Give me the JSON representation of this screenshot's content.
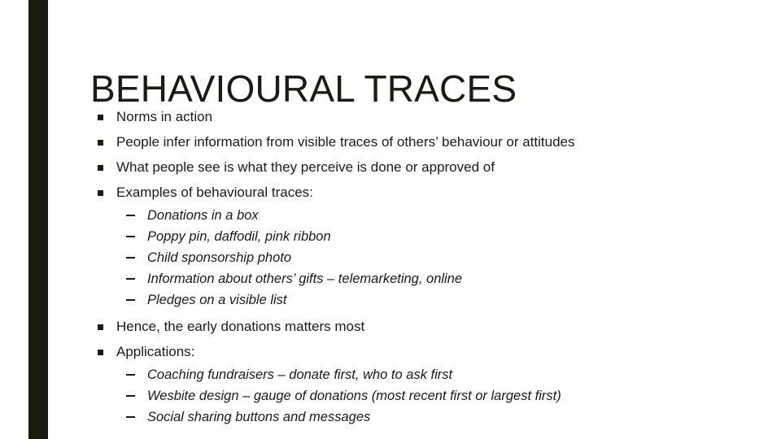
{
  "slide": {
    "title": "BEHAVIOURAL TRACES",
    "accent_color": "#1a1c10",
    "text_color": "#1a1a17",
    "background_color": "#ffffff",
    "bullet_marker": "filled-square",
    "sub_bullet_marker": "en-dash"
  },
  "content": {
    "items": [
      {
        "level": 1,
        "text": "Norms in action"
      },
      {
        "level": 1,
        "text": "People infer information from visible traces of others’ behaviour or attitudes"
      },
      {
        "level": 1,
        "text": "What people see is what they perceive is done or approved of"
      },
      {
        "level": 1,
        "text": "Examples of behavioural traces:"
      },
      {
        "level": 2,
        "text": "Donations in a box"
      },
      {
        "level": 2,
        "text": "Poppy pin, daffodil, pink ribbon"
      },
      {
        "level": 2,
        "text": "Child sponsorship photo"
      },
      {
        "level": 2,
        "text": "Information about others’ gifts – telemarketing, online"
      },
      {
        "level": 2,
        "text": "Pledges on a visible list"
      },
      {
        "level": 1,
        "text": "Hence, the early donations matters most"
      },
      {
        "level": 1,
        "text": "Applications:"
      },
      {
        "level": 2,
        "text": "Coaching fundraisers – donate first, who to ask first"
      },
      {
        "level": 2,
        "text": "Wesbite design – gauge of donations (most recent first or largest first)"
      },
      {
        "level": 2,
        "text": "Social sharing buttons and messages"
      }
    ]
  }
}
